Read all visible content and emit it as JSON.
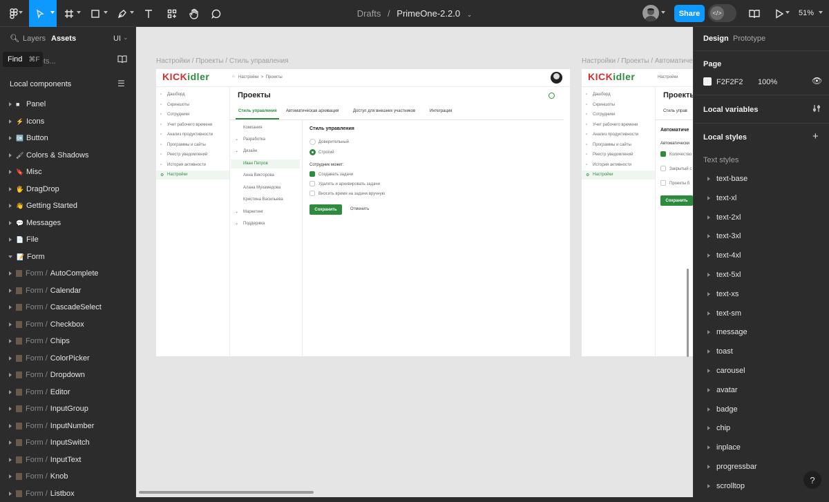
{
  "toolbar": {
    "breadcrumb_parent": "Drafts",
    "breadcrumb_sep": "/",
    "file_name": "PrimeOne-2.2.0",
    "share_label": "Share",
    "zoom": "51%"
  },
  "left_panel": {
    "tab_layers": "Layers",
    "tab_assets": "Assets",
    "library": "UI",
    "tooltip_find": "Find",
    "tooltip_shortcut": "⌘F",
    "search_placeholder": "…ets...",
    "local_components": "Local components",
    "items": [
      {
        "emoji": "■",
        "label": "Panel"
      },
      {
        "emoji": "⚡",
        "label": "Icons"
      },
      {
        "emoji": "🆗",
        "label": "Button"
      },
      {
        "emoji": "🖌",
        "label": "Colors & Shadows"
      },
      {
        "emoji": "🔖",
        "label": "Misc"
      },
      {
        "emoji": "🖐",
        "label": "DragDrop"
      },
      {
        "emoji": "👋",
        "label": "Getting Started"
      },
      {
        "emoji": "💬",
        "label": "Messages"
      },
      {
        "emoji": "📄",
        "label": "File"
      },
      {
        "emoji": "📝",
        "label": "Form"
      }
    ],
    "form_prefix": "Form /",
    "form_items": [
      "AutoComplete",
      "Calendar",
      "CascadeSelect",
      "Checkbox",
      "Chips",
      "ColorPicker",
      "Dropdown",
      "Editor",
      "InputGroup",
      "InputNumber",
      "InputSwitch",
      "InputText",
      "Knob",
      "Listbox"
    ]
  },
  "right_panel": {
    "tab_design": "Design",
    "tab_prototype": "Prototype",
    "page_heading": "Page",
    "page_color": "F2F2F2",
    "page_opacity": "100%",
    "local_variables": "Local variables",
    "local_styles": "Local styles",
    "text_styles_heading": "Text styles",
    "text_styles": [
      "text-base",
      "text-xl",
      "text-2xl",
      "text-3xl",
      "text-4xl",
      "text-5xl",
      "text-xs",
      "text-sm",
      "message",
      "toast",
      "carousel",
      "avatar",
      "badge",
      "chip",
      "inplace",
      "progressbar",
      "scrolltop"
    ],
    "help": "?"
  },
  "canvas": {
    "frame1_label": "Настройки / Проекты / Стиль управления",
    "frame2_label": "Настройки / Проекты / Автоматичес",
    "logo_a": "KICK",
    "logo_b": "idler",
    "crumb": "Настройки  >  Проекты",
    "nav": [
      "Дашборд",
      "Скриншоты",
      "Сотрудники",
      "Учет рабочего времени",
      "Анализ продуктивности",
      "Программы и сайты",
      "Реестр уведомлений",
      "История активности",
      "Настройки"
    ],
    "page_title": "Проекты",
    "tabs": [
      "Стиль управления",
      "Автоматическая архивация",
      "Доступ для внешних участников",
      "Интеграция"
    ],
    "tree": [
      "Компания",
      "Разработка",
      "Дизайн",
      "Иван Петров",
      "Анна Викторова",
      "Алана Мухамедова",
      "Кристина Васильева",
      "Маркетинг",
      "Поддержка"
    ],
    "section_title": "Стиль управления",
    "radio_trust": "Доверительный",
    "radio_strict": "Строгий",
    "can_label": "Сотрудник может:",
    "check1": "Создавать задачи",
    "check2": "Удалять и архивировать задачи",
    "check3": "Вносить время на задачи вручную",
    "save": "Сохранить",
    "cancel": "Отменить",
    "f2_title": "Проекты",
    "f2_tab": "Стиль управ",
    "f2_section": "Автоматиче",
    "f2_sub": "Автоматически",
    "f2_opt1": "Количество",
    "f2_opt2": "Закрытый с",
    "f2_opt3": "Проекты б",
    "f2_crumb": "Настройки"
  }
}
